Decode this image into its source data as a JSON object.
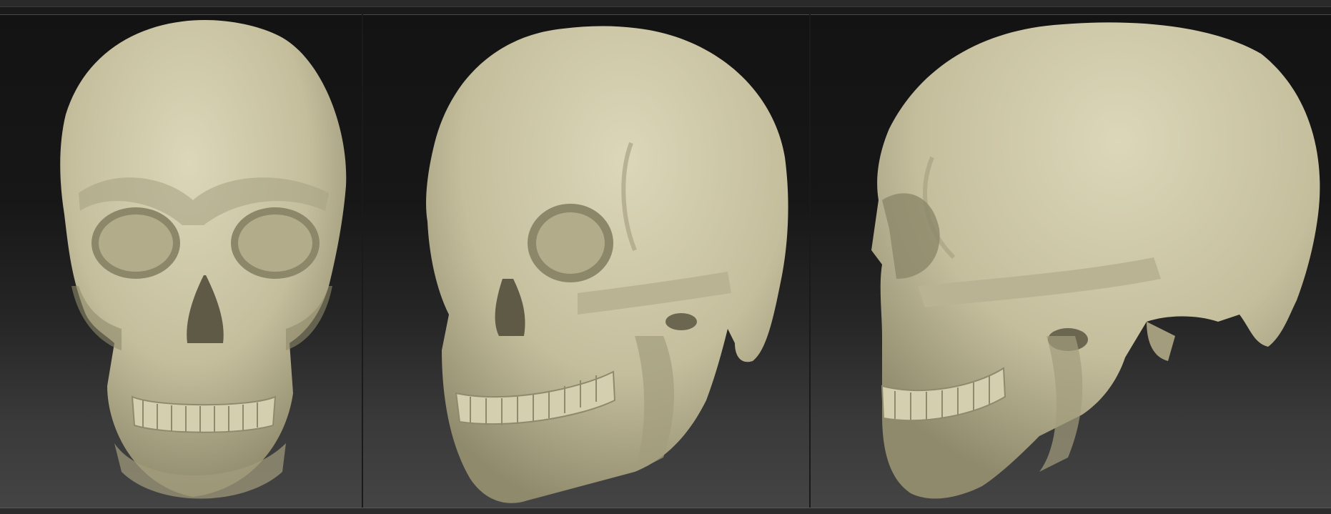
{
  "window": {
    "title": ""
  },
  "viewports": [
    {
      "view": "front",
      "object": "skull"
    },
    {
      "view": "three-quarter",
      "object": "skull"
    },
    {
      "view": "side",
      "object": "skull"
    }
  ],
  "colors": {
    "bone": "#c9c3a2",
    "bone_shadow": "#8f8a6b",
    "bone_highlight": "#dcd7b8",
    "background_top": "#131313",
    "background_bottom": "#444444"
  }
}
